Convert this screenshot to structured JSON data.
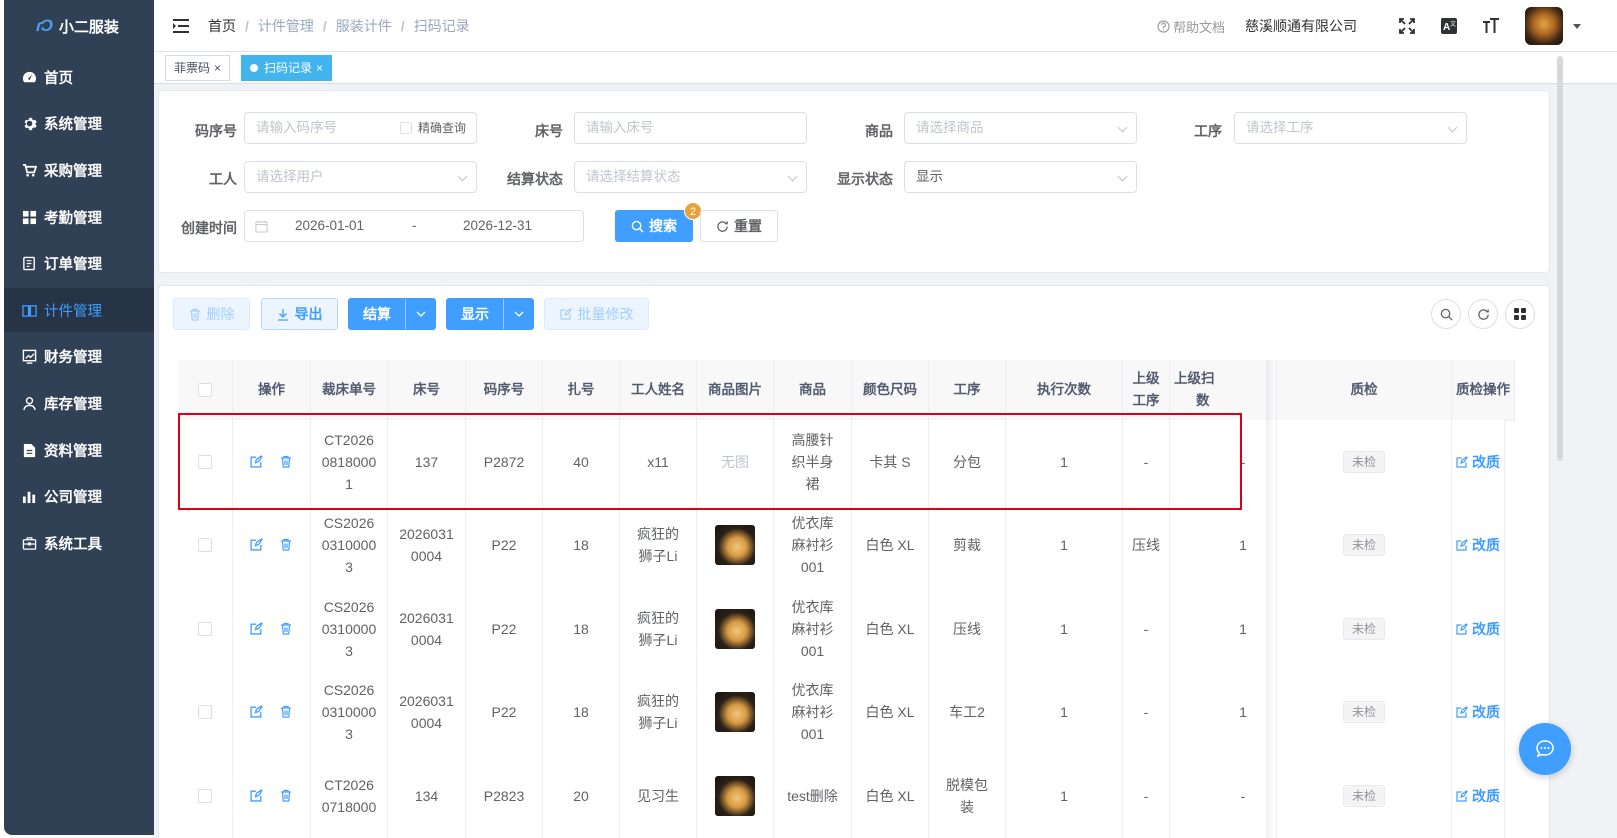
{
  "app": {
    "logo_text": "小二服装"
  },
  "sidebar": {
    "items": [
      {
        "label": "首页",
        "icon": "dashboard-icon"
      },
      {
        "label": "系统管理",
        "icon": "gear-icon"
      },
      {
        "label": "采购管理",
        "icon": "cart-icon"
      },
      {
        "label": "考勤管理",
        "icon": "grid-icon"
      },
      {
        "label": "订单管理",
        "icon": "order-icon"
      },
      {
        "label": "计件管理",
        "icon": "book-icon",
        "active": true
      },
      {
        "label": "财务管理",
        "icon": "chart-icon"
      },
      {
        "label": "库存管理",
        "icon": "user-icon"
      },
      {
        "label": "资料管理",
        "icon": "document-icon"
      },
      {
        "label": "公司管理",
        "icon": "bar-chart-icon"
      },
      {
        "label": "系统工具",
        "icon": "toolbox-icon"
      }
    ]
  },
  "navbar": {
    "breadcrumb": [
      "首页",
      "计件管理",
      "服装计件",
      "扫码记录"
    ],
    "help": "帮助文档",
    "company": "慈溪顺通有限公司"
  },
  "tags": [
    {
      "label": "菲票码",
      "active": false
    },
    {
      "label": "扫码记录",
      "active": true
    }
  ],
  "search": {
    "code_label": "码序号",
    "code_placeholder": "请输入码序号",
    "exact_label": "精确查询",
    "bed_label": "床号",
    "bed_placeholder": "请输入床号",
    "product_label": "商品",
    "product_placeholder": "请选择商品",
    "process_label": "工序",
    "process_placeholder": "请选择工序",
    "worker_label": "工人",
    "worker_placeholder": "请选择用户",
    "settle_label": "结算状态",
    "settle_placeholder": "请选择结算状态",
    "display_label": "显示状态",
    "display_value": "显示",
    "date_label": "创建时间",
    "date_start": "2026-01-01",
    "date_sep": "-",
    "date_end": "2026-12-31",
    "search_btn": "搜索",
    "search_badge": "2",
    "reset_btn": "重置"
  },
  "toolbar": {
    "delete": "删除",
    "export": "导出",
    "settle": "结算",
    "show": "显示",
    "batch_edit": "批量修改"
  },
  "table": {
    "headers": [
      "操作",
      "裁床单号",
      "床号",
      "码序号",
      "扎号",
      "工人姓名",
      "商品图片",
      "商品",
      "颜色尺码",
      "工序",
      "执行次数",
      "上级工序",
      "上级扫数",
      "质检",
      "质检操作"
    ],
    "headers_top": "上级扫",
    "headers_bottom": "数",
    "rows": [
      {
        "cut_no": "CT2026\n0818000\n1",
        "bed": "137",
        "code": "P2872",
        "bundle": "40",
        "worker": "x11",
        "image": "无图",
        "product": "高腰针\n织半身\n裙",
        "color_size": "卡其 S",
        "process": "分包",
        "count": "1",
        "parent": "-",
        "parent_count": "-",
        "qc": "未检",
        "qc_action": "改质"
      },
      {
        "cut_no": "CS2026\n0310000\n3",
        "bed": "2026031\n0004",
        "code": "P22",
        "bundle": "18",
        "worker": "疯狂的\n狮子Li",
        "image": "",
        "product": "优衣库\n麻衬衫\n001",
        "color_size": "白色 XL",
        "process": "剪裁",
        "count": "1",
        "parent": "压线",
        "parent_count": "1",
        "qc": "未检",
        "qc_action": "改质"
      },
      {
        "cut_no": "CS2026\n0310000\n3",
        "bed": "2026031\n0004",
        "code": "P22",
        "bundle": "18",
        "worker": "疯狂的\n狮子Li",
        "image": "",
        "product": "优衣库\n麻衬衫\n001",
        "color_size": "白色 XL",
        "process": "压线",
        "count": "1",
        "parent": "-",
        "parent_count": "1",
        "qc": "未检",
        "qc_action": "改质"
      },
      {
        "cut_no": "CS2026\n0310000\n3",
        "bed": "2026031\n0004",
        "code": "P22",
        "bundle": "18",
        "worker": "疯狂的\n狮子Li",
        "image": "",
        "product": "优衣库\n麻衬衫\n001",
        "color_size": "白色 XL",
        "process": "车工2",
        "count": "1",
        "parent": "-",
        "parent_count": "1",
        "qc": "未检",
        "qc_action": "改质"
      },
      {
        "cut_no": "CT2026\n0718000",
        "bed": "134",
        "code": "P2823",
        "bundle": "20",
        "worker": "见习生",
        "image": "",
        "product": "test删除",
        "color_size": "白色 XL",
        "process": "脱模包\n装",
        "count": "1",
        "parent": "-",
        "parent_count": "-",
        "qc": "未检",
        "qc_action": "改质"
      }
    ]
  },
  "colors": {
    "primary": "#409eff",
    "sidebar_bg": "#304156",
    "highlight": "#d9001b",
    "badge": "#e6a23c"
  }
}
